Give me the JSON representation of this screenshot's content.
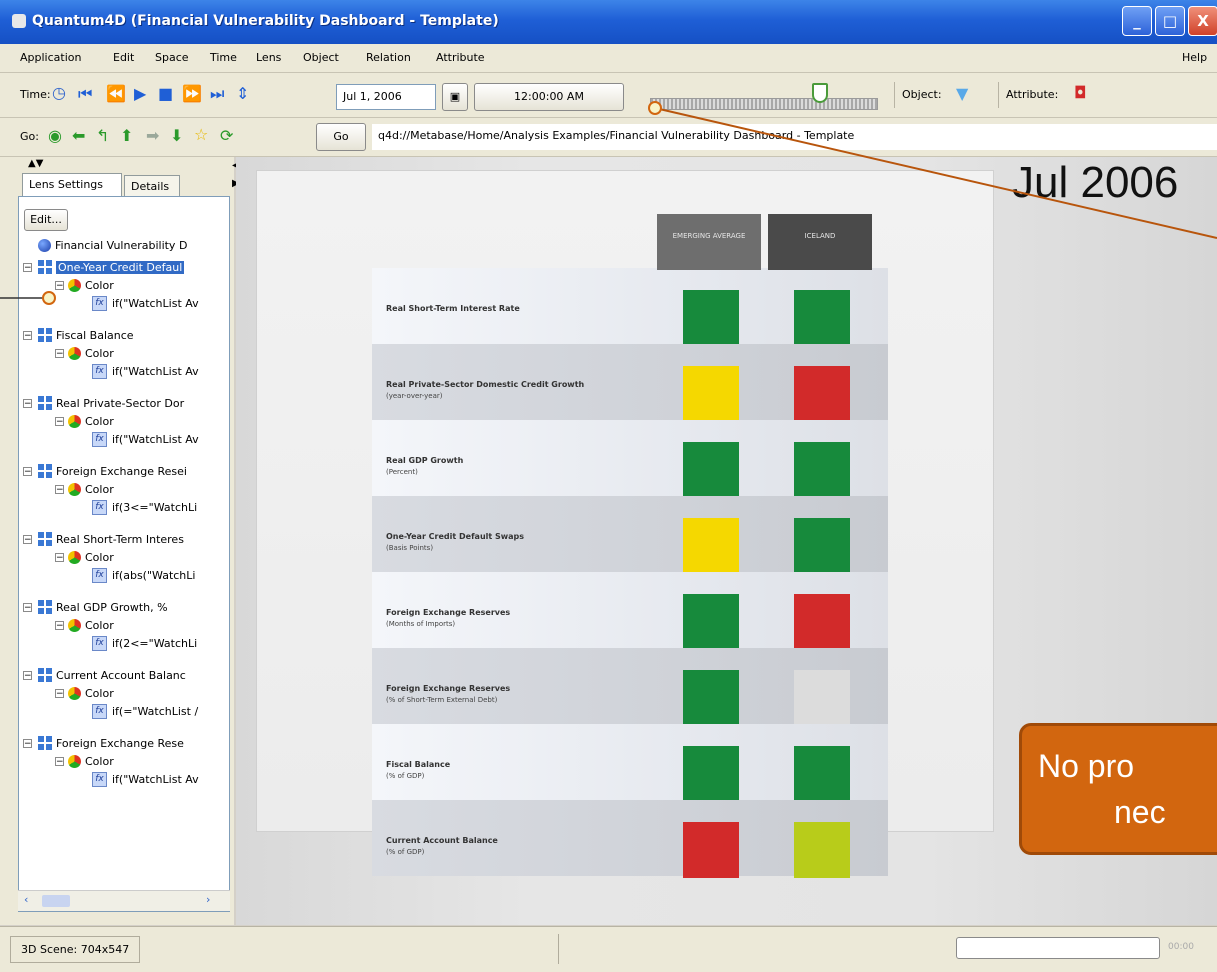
{
  "window": {
    "title": "Quantum4D (Financial Vulnerability Dashboard - Template)",
    "minimize_label": "_",
    "maximize_label": "□",
    "close_label": "X"
  },
  "menu": {
    "items": [
      "Application",
      "Edit",
      "Space",
      "Time",
      "Lens",
      "Object",
      "Relation",
      "Attribute"
    ],
    "help": "Help"
  },
  "timebar": {
    "time_label": "Time:",
    "date": "Jul 1, 2006",
    "time": "12:00:00 AM",
    "object_label": "Object:",
    "attribute_label": "Attribute:",
    "slider_position": 0.75
  },
  "gobar": {
    "go_label": "Go:",
    "go_button": "Go",
    "url": "q4d://Metabase/Home/Analysis Examples/Financial Vulnerability Dashboard - Template"
  },
  "panel": {
    "tabs": [
      "Lens Settings",
      "Details"
    ],
    "edit_button": "Edit...",
    "tree": {
      "root": "Financial Vulnerability D",
      "nodes": [
        {
          "label": "One-Year Credit Defaul",
          "selected": true,
          "color": "Color",
          "rule": "if(\"WatchList Av"
        },
        {
          "label": "Fiscal Balance",
          "color": "Color",
          "rule": "if(\"WatchList Av"
        },
        {
          "label": "Real Private-Sector Dor",
          "color": "Color",
          "rule": "if(\"WatchList Av"
        },
        {
          "label": "Foreign Exchange Resei",
          "color": "Color",
          "rule": "if(3<=\"WatchLi"
        },
        {
          "label": "Real Short-Term Interes",
          "color": "Color",
          "rule": "if(abs(\"WatchLi"
        },
        {
          "label": "Real GDP Growth, %",
          "color": "Color",
          "rule": "if(2<=\"WatchLi"
        },
        {
          "label": "Current Account Balanc",
          "color": "Color",
          "rule": "if(=\"WatchList /"
        },
        {
          "label": "Foreign Exchange Rese",
          "color": "Color",
          "rule": "if(\"WatchList Av"
        }
      ]
    }
  },
  "scene": {
    "month": "Jul 2006",
    "columns": [
      "EMERGING AVERAGE",
      "ICELAND"
    ],
    "rows": [
      {
        "title": "Real Short-Term Interest Rate",
        "sub": "",
        "emerging": "#178a3c",
        "iceland": "#178a3c"
      },
      {
        "title": "Real Private-Sector Domestic Credit Growth",
        "sub": "(year-over-year)",
        "emerging": "#f5d800",
        "iceland": "#d22a2a"
      },
      {
        "title": "Real GDP Growth",
        "sub": "(Percent)",
        "emerging": "#178a3c",
        "iceland": "#178a3c"
      },
      {
        "title": "One-Year Credit Default Swaps",
        "sub": "(Basis Points)",
        "emerging": "#f5d800",
        "iceland": "#178a3c"
      },
      {
        "title": "Foreign Exchange Reserves",
        "sub": "(Months of Imports)",
        "emerging": "#178a3c",
        "iceland": "#d22a2a"
      },
      {
        "title": "Foreign Exchange Reserves",
        "sub": "(% of Short-Term External Debt)",
        "emerging": "#178a3c",
        "iceland": "#dcdcdc"
      },
      {
        "title": "Fiscal Balance",
        "sub": "(% of GDP)",
        "emerging": "#178a3c",
        "iceland": "#178a3c"
      },
      {
        "title": "Current Account Balance",
        "sub": "(% of GDP)",
        "emerging": "#d22a2a",
        "iceland": "#b8cc1a"
      }
    ]
  },
  "callout": {
    "line1": "No pro",
    "line2": "nec"
  },
  "status": {
    "scene": "3D Scene: 704x547",
    "time": "00:00"
  }
}
